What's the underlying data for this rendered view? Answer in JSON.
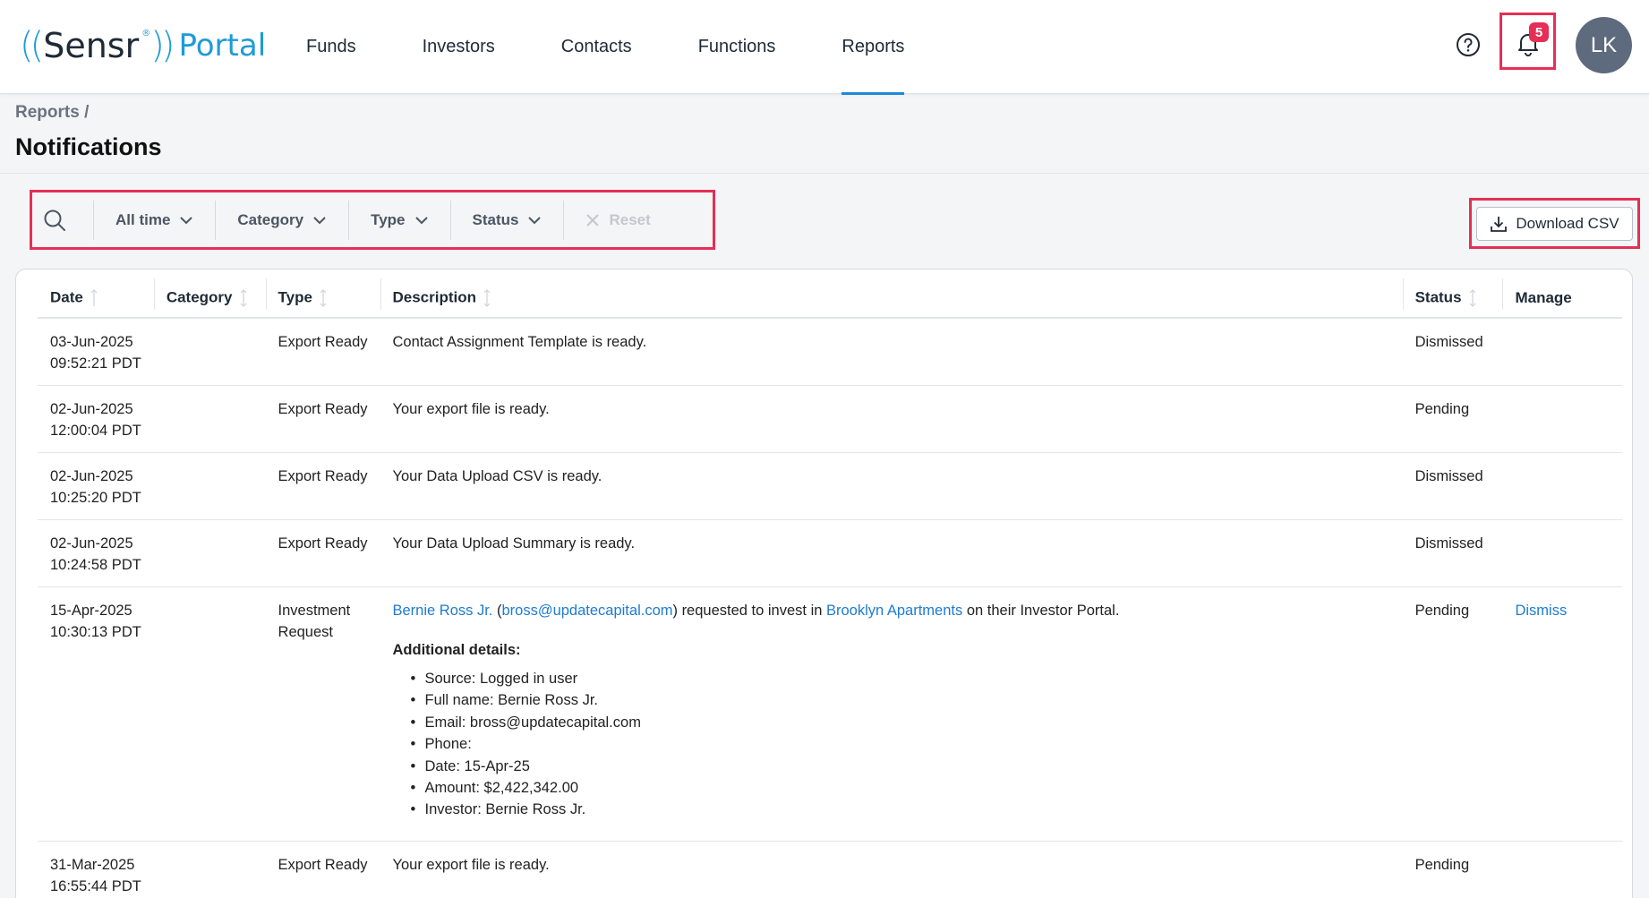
{
  "header": {
    "logo": {
      "open": "((",
      "sensr": "Sensr",
      "close": "))",
      "reg": "®",
      "portal": "Portal"
    },
    "nav": [
      {
        "label": "Funds",
        "active": false
      },
      {
        "label": "Investors",
        "active": false
      },
      {
        "label": "Contacts",
        "active": false
      },
      {
        "label": "Functions",
        "active": false
      },
      {
        "label": "Reports",
        "active": true
      }
    ],
    "notification_count": "5",
    "avatar_initials": "LK"
  },
  "page": {
    "breadcrumb": "Reports /",
    "title": "Notifications"
  },
  "filters": {
    "time": "All time",
    "category": "Category",
    "type": "Type",
    "status": "Status",
    "reset": "Reset"
  },
  "download_label": "Download CSV",
  "table": {
    "columns": {
      "date": "Date",
      "category": "Category",
      "type": "Type",
      "description": "Description",
      "status": "Status",
      "manage": "Manage"
    },
    "rows": [
      {
        "date": "03-Jun-2025",
        "time": "09:52:21 PDT",
        "category": "",
        "type": "Export Ready",
        "description": "Contact Assignment Template is ready.",
        "status": "Dismissed",
        "manage": ""
      },
      {
        "date": "02-Jun-2025",
        "time": "12:00:04 PDT",
        "category": "",
        "type": "Export Ready",
        "description": "Your export file is ready.",
        "status": "Pending",
        "manage": ""
      },
      {
        "date": "02-Jun-2025",
        "time": "10:25:20 PDT",
        "category": "",
        "type": "Export Ready",
        "description": "Your Data Upload CSV is ready.",
        "status": "Dismissed",
        "manage": ""
      },
      {
        "date": "02-Jun-2025",
        "time": "10:24:58 PDT",
        "category": "",
        "type": "Export Ready",
        "description": "Your Data Upload Summary is ready.",
        "status": "Dismissed",
        "manage": ""
      },
      {
        "date": "15-Apr-2025",
        "time": "10:30:13 PDT",
        "category": "",
        "type_line1": "Investment",
        "type_line2": "Request",
        "investor_link": "Bernie Ross Jr.",
        "open_paren": " (",
        "email_link": "bross@updatecapital.com",
        "text_mid": ") requested to invest in ",
        "fund_link": "Brooklyn Apartments",
        "text_end": " on their Investor Portal.",
        "details_title": "Additional details:",
        "details": [
          "Source: Logged in user",
          "Full name: Bernie Ross Jr.",
          "Email: bross@updatecapital.com",
          "Phone:",
          "Date: 15-Apr-25",
          "Amount: $2,422,342.00",
          "Investor: Bernie Ross Jr."
        ],
        "status": "Pending",
        "manage": "Dismiss"
      },
      {
        "date": "31-Mar-2025",
        "time": "16:55:44 PDT",
        "category": "",
        "type": "Export Ready",
        "description": "Your export file is ready.",
        "status": "Pending",
        "manage": ""
      }
    ]
  },
  "icons": [
    "help-icon",
    "bell-icon",
    "search-icon",
    "chevron-down-icon",
    "close-icon",
    "download-icon",
    "sort-icon"
  ],
  "colors": {
    "accent": "#1e88d8",
    "link": "#1e7bcf",
    "highlight": "#e52f56",
    "avatar": "#5e6a7d"
  }
}
